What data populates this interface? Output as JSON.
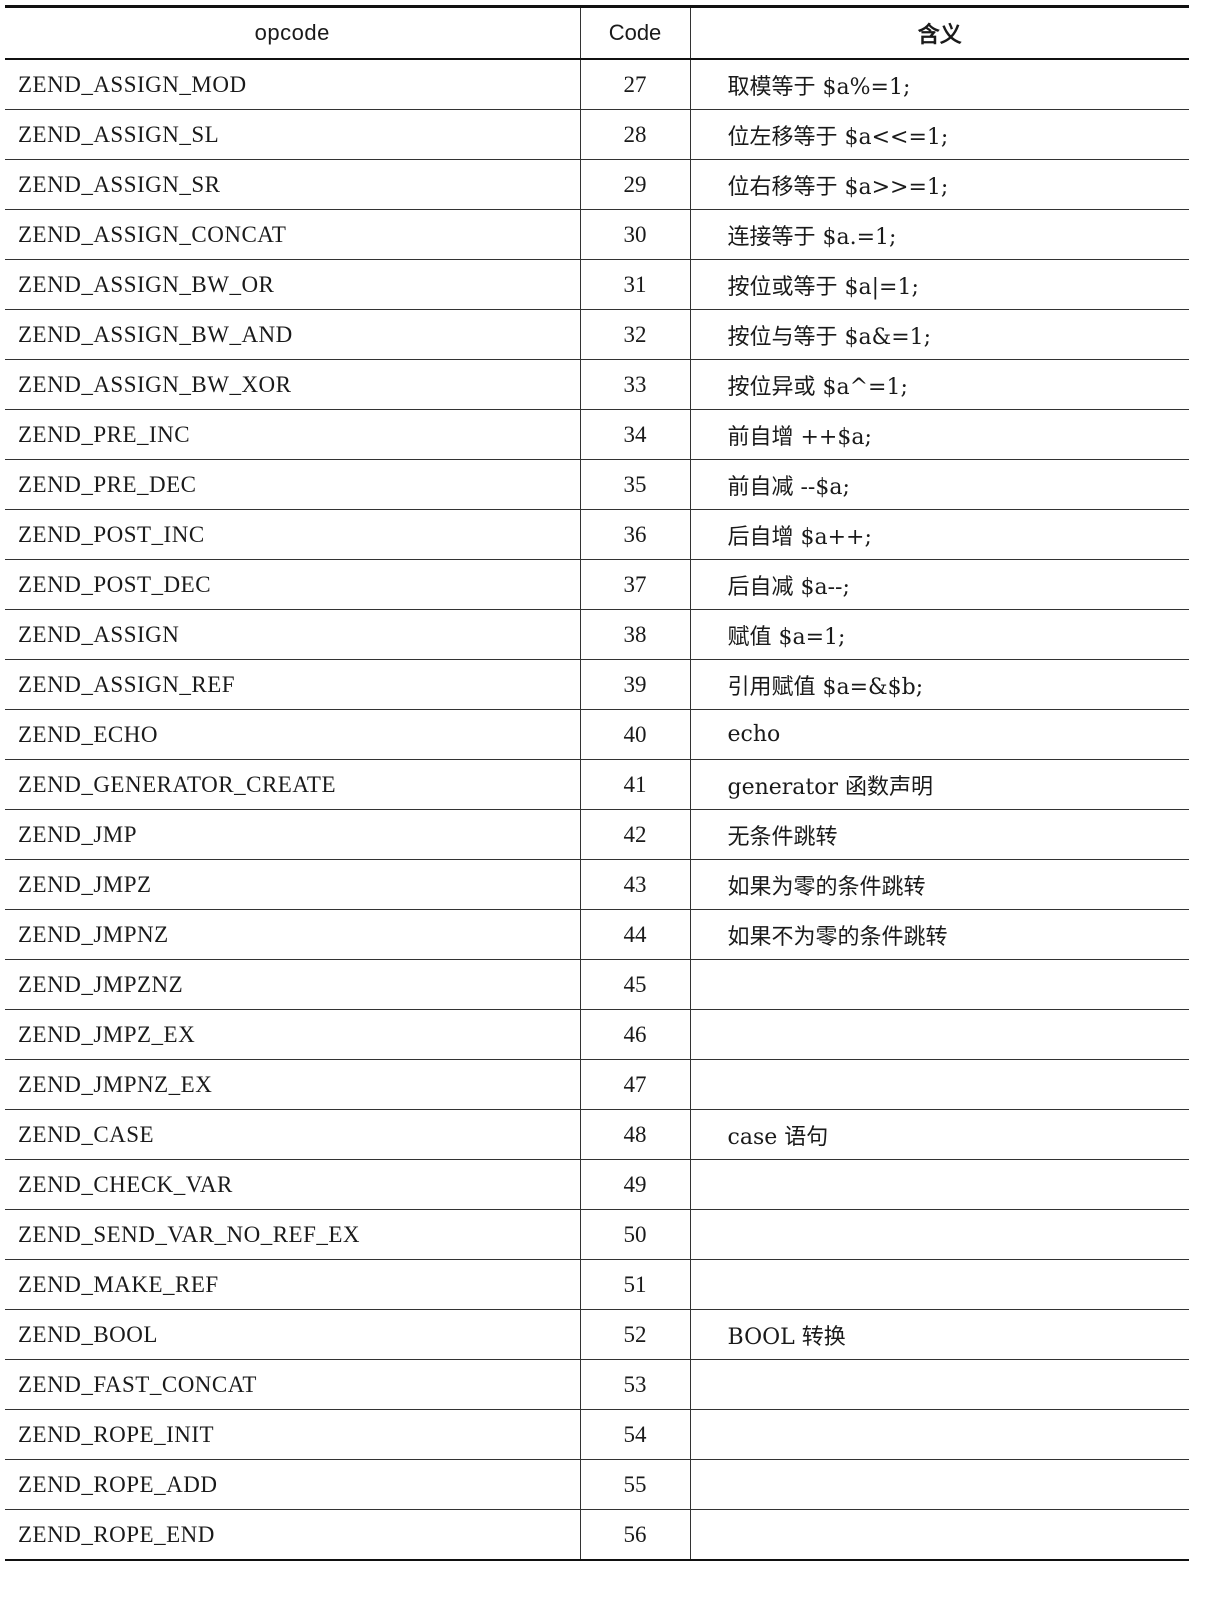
{
  "table": {
    "headers": [
      "opcode",
      "Code",
      "含义"
    ],
    "rows": [
      {
        "opcode": "ZEND_ASSIGN_MOD",
        "code": "27",
        "meaning": "取模等于 $a%=1;"
      },
      {
        "opcode": "ZEND_ASSIGN_SL",
        "code": "28",
        "meaning": "位左移等于 $a<<=1;"
      },
      {
        "opcode": "ZEND_ASSIGN_SR",
        "code": "29",
        "meaning": "位右移等于 $a>>=1;"
      },
      {
        "opcode": "ZEND_ASSIGN_CONCAT",
        "code": "30",
        "meaning": "连接等于 $a.=1;"
      },
      {
        "opcode": "ZEND_ASSIGN_BW_OR",
        "code": "31",
        "meaning": "按位或等于 $a|=1;"
      },
      {
        "opcode": "ZEND_ASSIGN_BW_AND",
        "code": "32",
        "meaning": "按位与等于 $a&=1;"
      },
      {
        "opcode": "ZEND_ASSIGN_BW_XOR",
        "code": "33",
        "meaning": "按位异或 $a^=1;"
      },
      {
        "opcode": "ZEND_PRE_INC",
        "code": "34",
        "meaning": "前自增 ++$a;"
      },
      {
        "opcode": "ZEND_PRE_DEC",
        "code": "35",
        "meaning": "前自减 --$a;"
      },
      {
        "opcode": "ZEND_POST_INC",
        "code": "36",
        "meaning": "后自增 $a++;"
      },
      {
        "opcode": "ZEND_POST_DEC",
        "code": "37",
        "meaning": "后自减 $a--;"
      },
      {
        "opcode": "ZEND_ASSIGN",
        "code": "38",
        "meaning": "赋值 $a=1;"
      },
      {
        "opcode": "ZEND_ASSIGN_REF",
        "code": "39",
        "meaning": "引用赋值 $a=&$b;"
      },
      {
        "opcode": "ZEND_ECHO",
        "code": "40",
        "meaning": "echo"
      },
      {
        "opcode": "ZEND_GENERATOR_CREATE",
        "code": "41",
        "meaning": "generator 函数声明"
      },
      {
        "opcode": "ZEND_JMP",
        "code": "42",
        "meaning": "无条件跳转"
      },
      {
        "opcode": "ZEND_JMPZ",
        "code": "43",
        "meaning": "如果为零的条件跳转"
      },
      {
        "opcode": "ZEND_JMPNZ",
        "code": "44",
        "meaning": "如果不为零的条件跳转"
      },
      {
        "opcode": "ZEND_JMPZNZ",
        "code": "45",
        "meaning": ""
      },
      {
        "opcode": "ZEND_JMPZ_EX",
        "code": "46",
        "meaning": ""
      },
      {
        "opcode": "ZEND_JMPNZ_EX",
        "code": "47",
        "meaning": ""
      },
      {
        "opcode": "ZEND_CASE",
        "code": "48",
        "meaning": "case 语句"
      },
      {
        "opcode": "ZEND_CHECK_VAR",
        "code": "49",
        "meaning": ""
      },
      {
        "opcode": "ZEND_SEND_VAR_NO_REF_EX",
        "code": "50",
        "meaning": ""
      },
      {
        "opcode": "ZEND_MAKE_REF",
        "code": "51",
        "meaning": ""
      },
      {
        "opcode": "ZEND_BOOL",
        "code": "52",
        "meaning": "BOOL 转换"
      },
      {
        "opcode": "ZEND_FAST_CONCAT",
        "code": "53",
        "meaning": ""
      },
      {
        "opcode": "ZEND_ROPE_INIT",
        "code": "54",
        "meaning": ""
      },
      {
        "opcode": "ZEND_ROPE_ADD",
        "code": "55",
        "meaning": ""
      },
      {
        "opcode": "ZEND_ROPE_END",
        "code": "56",
        "meaning": ""
      }
    ]
  }
}
